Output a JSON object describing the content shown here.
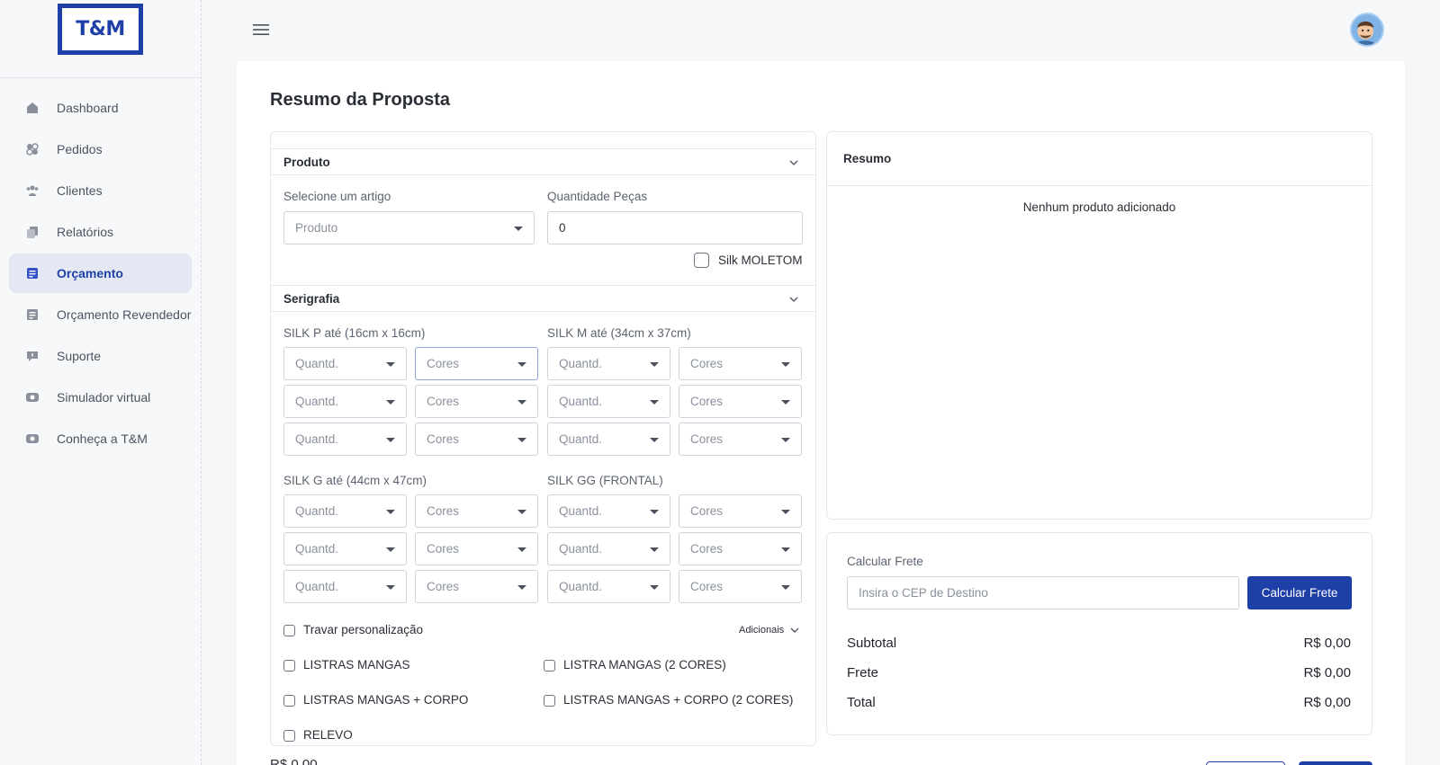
{
  "brand": {
    "logo_text": "T&M"
  },
  "sidebar": {
    "items": [
      {
        "label": "Dashboard",
        "icon": "home-icon"
      },
      {
        "label": "Pedidos",
        "icon": "orders-icon"
      },
      {
        "label": "Clientes",
        "icon": "users-icon"
      },
      {
        "label": "Relatórios",
        "icon": "reports-icon"
      },
      {
        "label": "Orçamento",
        "icon": "budget-icon",
        "active": true
      },
      {
        "label": "Orçamento Revendedor",
        "icon": "budget-reseller-icon"
      },
      {
        "label": "Suporte",
        "icon": "support-icon"
      },
      {
        "label": "Simulador virtual",
        "icon": "simulator-icon"
      },
      {
        "label": "Conheça a T&M",
        "icon": "about-icon"
      }
    ]
  },
  "page": {
    "title": "Resumo da Proposta"
  },
  "produto": {
    "section_title": "Produto",
    "artigo_label": "Selecione um artigo",
    "artigo_placeholder": "Produto",
    "quantidade_label": "Quantidade Peças",
    "quantidade_value": "0",
    "silk_moletom_label": "Silk MOLETOM"
  },
  "serigrafia": {
    "section_title": "Serigrafia",
    "groups": [
      {
        "label": "SILK P até (16cm x 16cm)"
      },
      {
        "label": "SILK M até (34cm x 37cm)"
      },
      {
        "label": "SILK G até (44cm x 47cm)"
      },
      {
        "label": "SILK GG (FRONTAL)"
      }
    ],
    "qty_placeholder": "Quantd.",
    "colors_placeholder": "Cores"
  },
  "options": {
    "travar_label": "Travar personalização",
    "adicionais_label": "Adicionais",
    "extras": [
      "LISTRAS MANGAS",
      "LISTRA MANGAS (2 CORES)",
      "LISTRAS MANGAS + CORPO",
      "LISTRAS MANGAS + CORPO (2 CORES)",
      "RELEVO"
    ]
  },
  "resumo": {
    "title": "Resumo",
    "empty_message": "Nenhum produto adicionado"
  },
  "frete": {
    "label": "Calcular Frete",
    "cep_placeholder": "Insira o CEP de Destino",
    "button_label": "Calcular Frete"
  },
  "totals": {
    "subtotal_label": "Subtotal",
    "subtotal_value": "R$ 0,00",
    "frete_label": "Frete",
    "frete_value": "R$ 0,00",
    "total_label": "Total",
    "total_value": "R$ 0,00"
  },
  "footer": {
    "price": "R$ 0,00"
  },
  "colors": {
    "primary": "#1f3fa8",
    "sidebar_active_bg": "#e3e8f3"
  }
}
